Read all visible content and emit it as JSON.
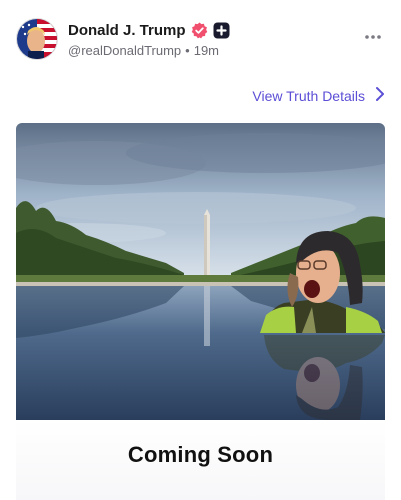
{
  "post": {
    "author": {
      "display_name": "Donald J. Trump",
      "handle": "@realDonaldTrump",
      "separator": "•",
      "time_ago": "19m",
      "verified_icon": "verified-badge-icon",
      "plus_icon": "plus-badge-icon"
    },
    "more_icon": "more-horizontal-icon",
    "details_link": {
      "label": "View Truth Details",
      "icon": "chevron-right-icon"
    },
    "media": {
      "caption": "Coming Soon"
    }
  },
  "colors": {
    "accent": "#5b4fd6",
    "verified": "#f0506e",
    "text_primary": "#1a1a1a",
    "text_secondary": "#6b6b73"
  }
}
